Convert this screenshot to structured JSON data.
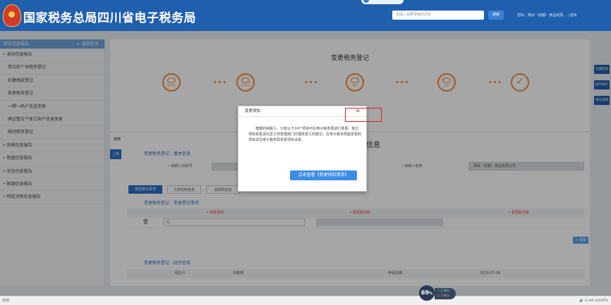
{
  "header": {
    "title": "国家税务总局四川省电子税务局",
    "search_placeholder": "请输入需要搜索的内容",
    "search_button": "搜索",
    "user_info": "您好，网点（成都）食品有限...",
    "logout": "退出"
  },
  "sidebar": {
    "heading": "综合信息报告",
    "back_home": "← 返回主页",
    "items": [
      {
        "label": "• 身份信息报告",
        "level": "top"
      },
      {
        "label": "单位和个体税务登记",
        "level": "sub"
      },
      {
        "label": "扣缴税款登记",
        "level": "sub"
      },
      {
        "label": "变更税务登记",
        "level": "sub"
      },
      {
        "label": "一照一码户信息变更",
        "level": "sub"
      },
      {
        "label": "两证整合个体工商户信息变更",
        "level": "sub"
      },
      {
        "label": "临时税务登记",
        "level": "sub"
      },
      {
        "label": "• 资格信息报告",
        "level": "top"
      },
      {
        "label": "• 制度信息报告",
        "level": "top"
      },
      {
        "label": "• 状态信息报告",
        "level": "top"
      },
      {
        "label": "• 税源信息报告",
        "level": "top"
      },
      {
        "label": "• 特定涉税信息报告",
        "level": "top"
      }
    ]
  },
  "main": {
    "page_title": "变更税务登记",
    "steps": [
      "填写信息",
      "提交申请",
      "审核",
      "反馈"
    ],
    "dots": "•••",
    "right_buttons": [
      "页面帮助",
      "操作指示",
      "填写说明"
    ]
  },
  "panel": {
    "tab_label": "上传",
    "corner_label": "填表",
    "section1_title": "变更税务登记 - 基本信息",
    "section1_center": "信息",
    "taxpayer_id_label": "• 纳税人识别号",
    "taxpayer_name_label": "• 纳税人名称",
    "taxpayer_name_value": "网点（成都）食品有限公司",
    "tabs": [
      "变更登记事项",
      "分支机构信息",
      "总机构信息"
    ],
    "section2_title": "变更税务登记 - 变更登记事项",
    "grid_headers": [
      "• 变更项目",
      "• 变更前内容",
      "• 变更后内容"
    ],
    "add_button": "+ 添加",
    "section3_title": "变更税务登记 - 经办信息",
    "handler_label": "经办人",
    "handler_value": "刘春燕",
    "apply_date_label": "申请日期",
    "apply_date_value": "2019-07-09"
  },
  "modal": {
    "title": "变更须知",
    "body": "尊敬的纳税人，只有以下24个项目可在电子税务局进行变更，其它项目变更请先至工商管理部门办理变更工商登记，在电子税务局能变更的项目详见电子税务局变更项目清单。",
    "button": "点击查看《变更项目清单》"
  },
  "statusbar": {
    "left": "完成",
    "speed_value": "69",
    "speed_unit": "%",
    "up": "↑ 1.3K/s",
    "down": "↓ 3.9K/s",
    "right": "🔊 ⊡ ⊕0 ⊕100%"
  }
}
